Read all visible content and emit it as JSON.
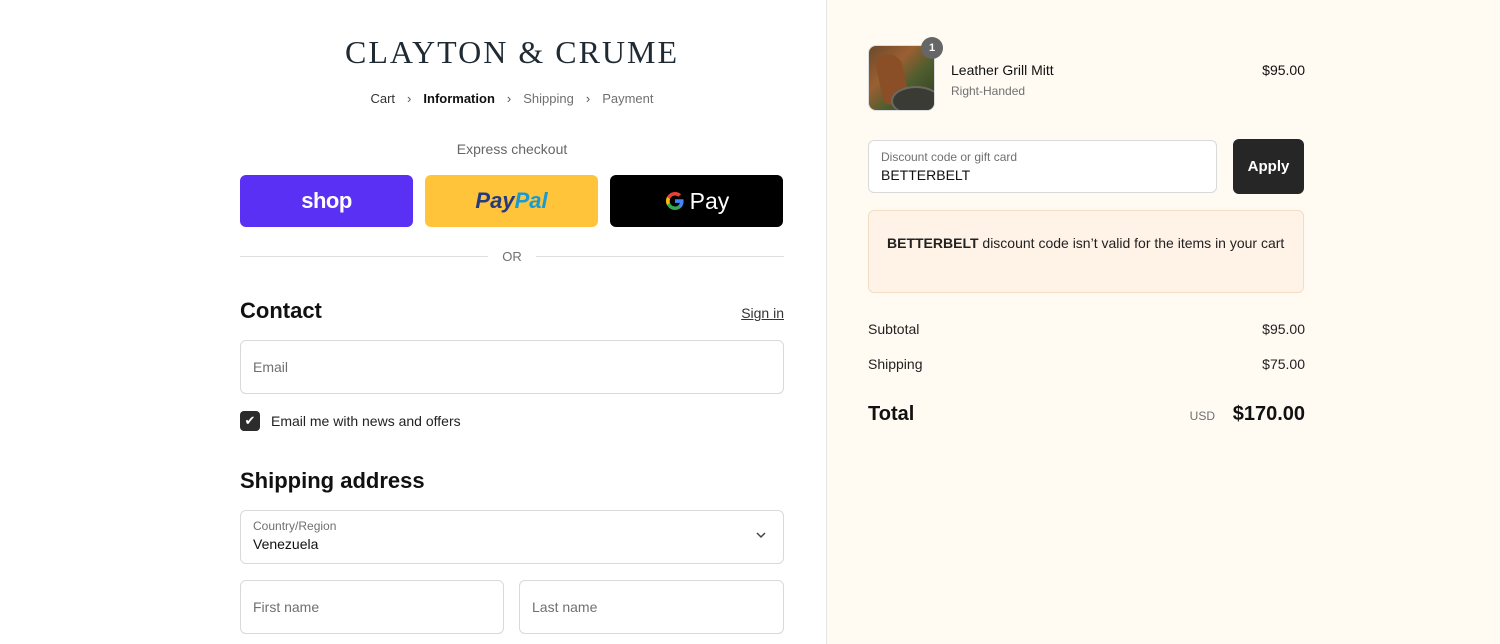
{
  "brand": {
    "name": "CLAYTON & CRUME"
  },
  "breadcrumb": {
    "items": [
      "Cart",
      "Information",
      "Shipping",
      "Payment"
    ],
    "active": "Information"
  },
  "express": {
    "label": "Express checkout",
    "shop_label": "shop",
    "paypal_part1": "Pay",
    "paypal_part2": "Pal",
    "gpay_g": "G",
    "gpay_label": "Pay",
    "or_label": "OR"
  },
  "contact": {
    "heading": "Contact",
    "sign_in": "Sign in",
    "email_placeholder": "Email",
    "newsletter_checked": true,
    "newsletter_label": "Email me with news and offers"
  },
  "shipping_address": {
    "heading": "Shipping address",
    "country_label": "Country/Region",
    "country_value": "Venezuela",
    "first_name_placeholder": "First name",
    "last_name_placeholder": "Last name"
  },
  "cart": {
    "item": {
      "quantity": "1",
      "name": "Leather Grill Mitt",
      "variant": "Right-Handed",
      "price": "$95.00"
    }
  },
  "discount": {
    "label": "Discount code or gift card",
    "value": "BETTERBELT",
    "apply_label": "Apply",
    "error_code": "BETTERBELT",
    "error_message": " discount code isn’t valid for the items in your cart"
  },
  "summary": {
    "subtotal_label": "Subtotal",
    "subtotal_value": "$95.00",
    "shipping_label": "Shipping",
    "shipping_value": "$75.00",
    "total_label": "Total",
    "currency": "USD",
    "total_value": "$170.00"
  },
  "colors": {
    "shop_purple": "#5a31f4",
    "paypal_yellow": "#ffc439",
    "summary_bg": "#fffbf2",
    "error_bg": "#fff3e8"
  }
}
